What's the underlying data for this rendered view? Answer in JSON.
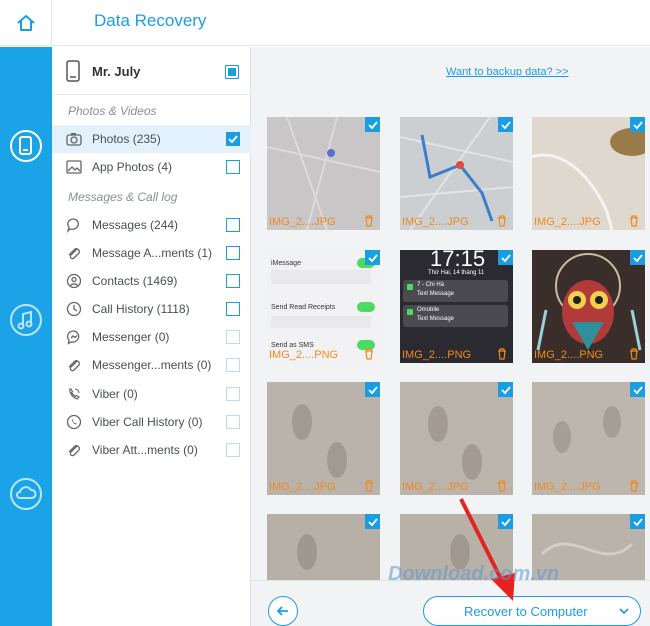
{
  "app": {
    "title": "Data Recovery"
  },
  "device": {
    "name": "Mr. July"
  },
  "sections": {
    "photos_videos": "Photos & Videos",
    "messages_calllog": "Messages & Call log"
  },
  "items": [
    {
      "label": "Photos (235)"
    },
    {
      "label": "App Photos (4)"
    },
    {
      "label": "Messages (244)"
    },
    {
      "label": "Message A...ments (1)"
    },
    {
      "label": "Contacts (1469)"
    },
    {
      "label": "Call History (1118)"
    },
    {
      "label": "Messenger (0)"
    },
    {
      "label": "Messenger...ments (0)"
    },
    {
      "label": "Viber (0)"
    },
    {
      "label": "Viber Call History (0)"
    },
    {
      "label": "Viber Att...ments (0)"
    }
  ],
  "backup_link": "Want to backup data? >>",
  "tiles": [
    {
      "caption": "IMG_2....JPG"
    },
    {
      "caption": "IMG_2....JPG"
    },
    {
      "caption": "IMG_2....JPG"
    },
    {
      "caption": "IMG_2....PNG"
    },
    {
      "caption": "IMG_2....PNG"
    },
    {
      "caption": "IMG_2....PNG"
    },
    {
      "caption": "IMG_2....JPG"
    },
    {
      "caption": "IMG_2....JPG"
    },
    {
      "caption": "IMG_2....JPG"
    },
    {
      "caption": ""
    },
    {
      "caption": ""
    },
    {
      "caption": ""
    }
  ],
  "screenshot_texts": {
    "imessage": "iMessage",
    "read_receipts": "Send Read Receipts",
    "send_sms": "Send as SMS",
    "lock_time": "17:15",
    "lock_date": "Thứ Hai, 14 tháng 11",
    "notif1_title": "7 - Chi Hà",
    "notif1_body": "Text Message",
    "notif2_title": "Omobile",
    "notif2_body": "Text Message"
  },
  "recover_button": "Recover to Computer",
  "watermark": "Download.com.vn",
  "colors": {
    "accent": "#1a9ee2",
    "rail": "#1aa3e6",
    "caption": "#f08a1e"
  }
}
